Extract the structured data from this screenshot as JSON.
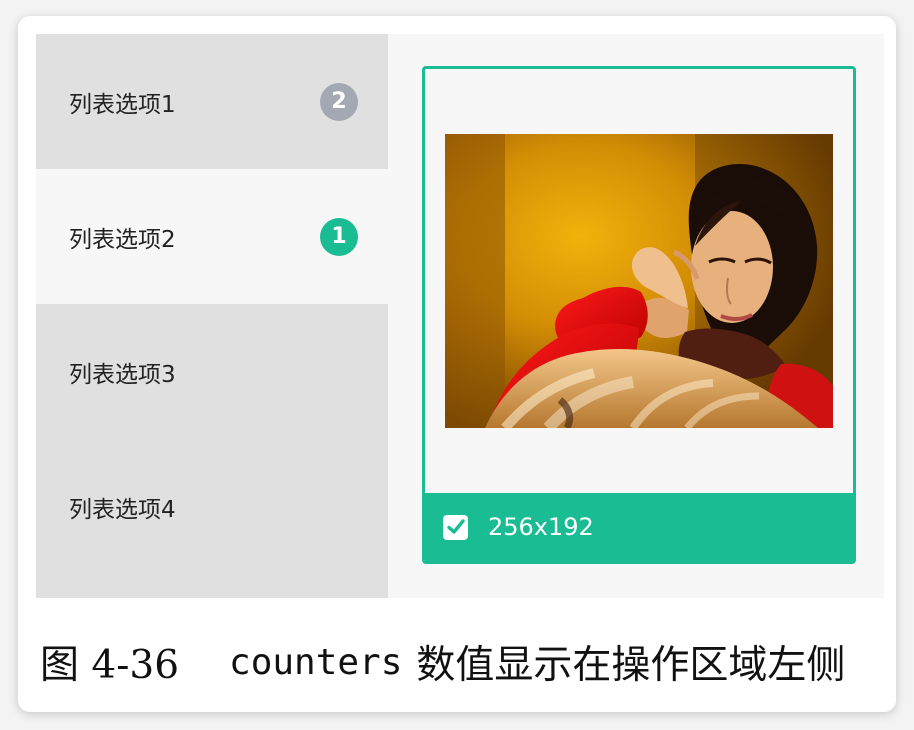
{
  "sidebar": {
    "items": [
      {
        "label": "列表选项1",
        "counter": "2",
        "counter_color": "#a3a8b2"
      },
      {
        "label": "列表选项2",
        "counter": "1",
        "counter_color": "#1abc94",
        "active": true
      },
      {
        "label": "列表选项3"
      },
      {
        "label": "列表选项4"
      }
    ]
  },
  "photo_card": {
    "image": "photo-of-woman",
    "checked": true,
    "size_text": "256x192",
    "accent": "#1abc94"
  },
  "caption": {
    "figure_no": "图 4-36",
    "code": "counters",
    "text": "数值显示在操作区域左侧"
  }
}
